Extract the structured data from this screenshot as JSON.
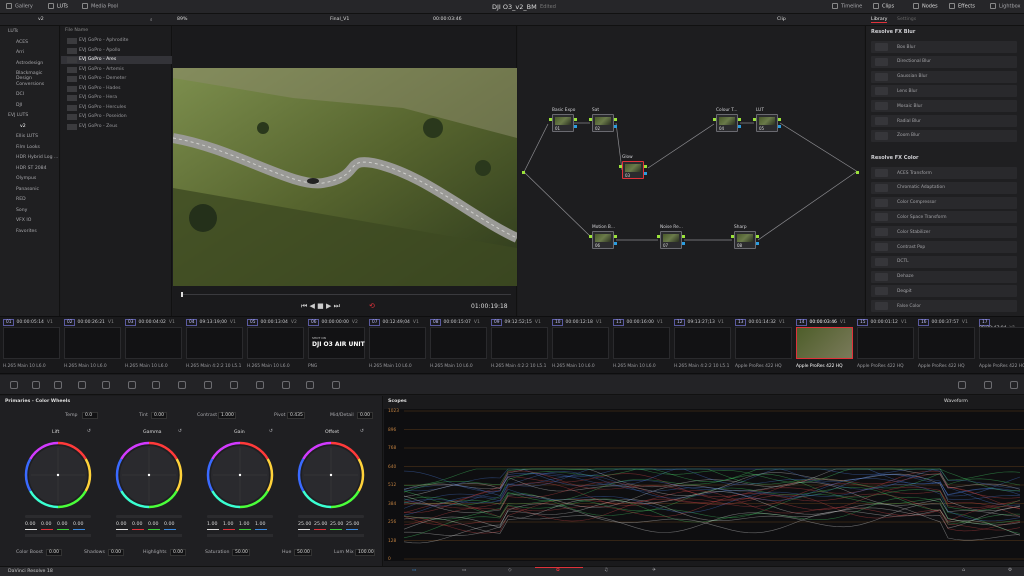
{
  "topbar": {
    "gallery": "Gallery",
    "luts": "LUTs",
    "media_pool": "Media Pool",
    "project_title": "DJI O3_v2_BM",
    "edited": "Edited",
    "timeline": "Timeline",
    "clips": "Clips",
    "nodes": "Nodes",
    "effects": "Effects",
    "lightbox": "Lightbox"
  },
  "viewer_bar": {
    "folder": "v2",
    "zoom": "89%",
    "timeline_name": "Final_V1",
    "timecode": "00:00:03:46",
    "mode": "Clip",
    "library_tab": "Library",
    "settings_tab": "Settings"
  },
  "lut_tree": {
    "items": [
      "LUTs",
      "ACES",
      "Arri",
      "Astrodesign",
      "Blackmagic Design",
      "Conversions",
      "DCI",
      "DJI",
      "EVJ LUTS",
      "v2",
      "Ellis LUTS",
      "Film Looks",
      "HDR Hybrid Log ...",
      "HDR ST 2084",
      "Olympus",
      "Panasonic",
      "RED",
      "Sony",
      "VFX IO",
      "Favorites"
    ]
  },
  "file_list": {
    "header": "File Name",
    "items": [
      "EVJ GoPro - Aphrodite",
      "EVJ GoPro - Apollo",
      "EVJ GoPro - Ares",
      "EVJ GoPro - Artemis",
      "EVJ GoPro - Demeter",
      "EVJ GoPro - Hades",
      "EVJ GoPro - Hera",
      "EVJ GoPro - Hercules",
      "EVJ GoPro - Poseidon",
      "EVJ GoPro - Zeus"
    ]
  },
  "viewer": {
    "timecode": "01:00:19:18"
  },
  "node_graph": {
    "nodes": [
      {
        "label": "Basic Expo",
        "num": "01"
      },
      {
        "label": "Sat",
        "num": "02"
      },
      {
        "label": "Glow",
        "num": "03"
      },
      {
        "label": "Colour T...",
        "num": "04"
      },
      {
        "label": "LUT",
        "num": "05"
      },
      {
        "label": "Motion B...",
        "num": "06"
      },
      {
        "label": "Noise Re...",
        "num": "07"
      },
      {
        "label": "Sharp",
        "num": "08"
      }
    ]
  },
  "library": {
    "blur_header": "Resolve FX Blur",
    "blur_items": [
      "Box Blur",
      "Directional Blur",
      "Gaussian Blur",
      "Lens Blur",
      "Mosaic Blur",
      "Radial Blur",
      "Zoom Blur"
    ],
    "color_header": "Resolve FX Color",
    "color_items": [
      "ACES Transform",
      "Chromatic Adaptation",
      "Color Compressor",
      "Color Space Transform",
      "Color Stabilizer",
      "Contrast Pop",
      "DCTL",
      "Dehaze",
      "Deqpit",
      "False Color"
    ]
  },
  "clips": [
    {
      "num": "01",
      "tc": "00:00:05:14",
      "track": "V1",
      "label": "H.265 Main 10 L6.0"
    },
    {
      "num": "02",
      "tc": "00:00:26:21",
      "track": "V1",
      "label": "H.265 Main 10 L6.0"
    },
    {
      "num": "03",
      "tc": "00:00:04:02",
      "track": "V1",
      "label": "H.265 Main 10 L6.0"
    },
    {
      "num": "04",
      "tc": "09:13:19;00",
      "track": "V1",
      "label": "H.265 Main 4:2:2 10 L5.1"
    },
    {
      "num": "05",
      "tc": "00:00:13:04",
      "track": "V2",
      "label": "H.265 Main 10 L6.0"
    },
    {
      "num": "06",
      "tc": "00:00:00:00",
      "track": "V2",
      "label": "PNG"
    },
    {
      "num": "07",
      "tc": "00:12:49;04",
      "track": "V1",
      "label": "H.265 Main 10 L6.0"
    },
    {
      "num": "08",
      "tc": "00:00:15:07",
      "track": "V1",
      "label": "H.265 Main 10 L6.0"
    },
    {
      "num": "09",
      "tc": "09:12:52;15",
      "track": "V1",
      "label": "H.265 Main 4:2:2 10 L5.1"
    },
    {
      "num": "10",
      "tc": "00:00:12:18",
      "track": "V1",
      "label": "H.265 Main 10 L6.0"
    },
    {
      "num": "11",
      "tc": "00:00:16:00",
      "track": "V1",
      "label": "H.265 Main 10 L6.0"
    },
    {
      "num": "12",
      "tc": "09:13:27;13",
      "track": "V1",
      "label": "H.265 Main 4:2:2 10 L5.1"
    },
    {
      "num": "13",
      "tc": "00:01:14:32",
      "track": "V1",
      "label": "Apple ProRes 422 HQ"
    },
    {
      "num": "14",
      "tc": "00:00:03:46",
      "track": "V1",
      "label": "Apple ProRes 422 HQ"
    },
    {
      "num": "15",
      "tc": "00:00:01:12",
      "track": "V1",
      "label": "Apple ProRes 422 HQ"
    },
    {
      "num": "16",
      "tc": "00:00:37:57",
      "track": "V1",
      "label": "Apple ProRes 422 HQ"
    },
    {
      "num": "17",
      "tc": "00:00:47:04",
      "track": "V1",
      "label": "Apple ProRes 422 HQ"
    }
  ],
  "title_card": {
    "small": "SHOT ON",
    "big": "DJI O3 AIR UNIT"
  },
  "primaries": {
    "title": "Primaries - Color Wheels",
    "temp_label": "Temp",
    "temp": "0.0",
    "tint_label": "Tint",
    "tint": "0.00",
    "contrast_label": "Contrast",
    "contrast": "1.000",
    "pivot_label": "Pivot",
    "pivot": "0.435",
    "middetail_label": "Mid/Detail",
    "middetail": "0.00",
    "wheels": [
      {
        "name": "Lift",
        "values": [
          "0.00",
          "0.00",
          "0.00",
          "0.00"
        ]
      },
      {
        "name": "Gamma",
        "values": [
          "0.00",
          "0.00",
          "0.00",
          "0.00"
        ]
      },
      {
        "name": "Gain",
        "values": [
          "1.00",
          "1.00",
          "1.00",
          "1.00"
        ]
      },
      {
        "name": "Offset",
        "values": [
          "25.00",
          "25.00",
          "25.00",
          "25.00"
        ]
      }
    ],
    "color_boost_label": "Color Boost",
    "color_boost": "0.00",
    "shadows_label": "Shadows",
    "shadows": "0.00",
    "highlights_label": "Highlights",
    "highlights": "0.00",
    "saturation_label": "Saturation",
    "saturation": "50.00",
    "hue_label": "Hue",
    "hue": "50.00",
    "lummix_label": "Lum Mix",
    "lummix": "100.00"
  },
  "scopes": {
    "title": "Scopes",
    "type": "Waveform",
    "ticks": [
      "1023",
      "896",
      "768",
      "640",
      "512",
      "384",
      "256",
      "128",
      "0"
    ]
  },
  "bottom": {
    "app": "DaVinci Resolve 18"
  },
  "colors": {
    "accent_red": "#e0323a",
    "node_green": "#9be33a",
    "node_blue": "#2a9de0"
  }
}
